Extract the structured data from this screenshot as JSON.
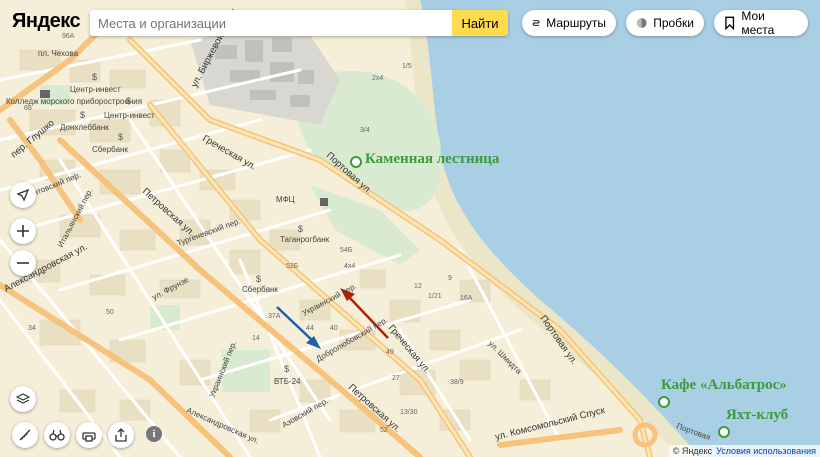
{
  "header": {
    "logo": "Яндекс",
    "search_placeholder": "Места и организации",
    "search_button": "Найти",
    "routes_label": "Маршруты",
    "traffic_label": "Пробки",
    "places_label": "Мои места"
  },
  "poi": {
    "stone_stairs": "Каменная лестница",
    "cafe": "Кафе «Альбатрос»",
    "yacht_club": "Яхт-клуб"
  },
  "streets": {
    "birzhevoy": "ул. Биржевой Спуск",
    "chekhova": "пл. Чехова",
    "glushko": "пер. Глушко",
    "grecheskaya_top": "Греческая ул.",
    "portovaya_top": "Портовая ул.",
    "petrovskaya_top": "Петровская ул.",
    "montovsky": "Монтовский пер.",
    "italyansky": "Итальянский пер.",
    "turgenevsky": "Тургеневский пер.",
    "aleksandrovskaya": "Александровская ул.",
    "frunze": "ул. Фрунзе",
    "ukrainsky_top": "Украинский пер.",
    "dobrolyubovsky": "Добролюбовский пер.",
    "ukrainsky_bottom": "Украинский пер.",
    "grecheskaya_bottom": "Греческая ул.",
    "shmidta": "ул. Шмидта",
    "portovaya_bottom": "Портовая ул.",
    "komsomolsky": "ул. Комсомольский Спуск",
    "petrovskaya_bottom": "Петровская ул.",
    "aleksandrovskaya_bottom": "Александровская ул.",
    "azovsky": "Азовский пер.",
    "portovaya_corner": "Портовая"
  },
  "labels": {
    "center_invest1": "Центр-инвест",
    "center_invest2": "Центр-инвест",
    "college": "Колледж морского приборостроения",
    "donkhlebbank": "Донхлеббанк",
    "sberbank1": "Сбербанк",
    "mfc": "МФЦ",
    "taganrogbank": "Таганрогбанк",
    "sberbank2": "Сбербанк",
    "vtb": "ВТБ-24"
  },
  "numbers": [
    "96А",
    "68",
    "2х4",
    "1/5",
    "3/4",
    "54Б",
    "52Б",
    "4х4",
    "1/21",
    "16А",
    "12",
    "44",
    "40",
    "37А",
    "14",
    "9",
    "38/9",
    "49",
    "27",
    "13/30",
    "52",
    "34",
    "50"
  ],
  "footer": {
    "copyright": "© Яндекс",
    "terms": "Условия использования"
  },
  "colors": {
    "sea": "#a9cfe4",
    "land": "#f5efd9",
    "park": "#d8ead0",
    "main_road": "#f7c27c",
    "arrow_red": "#b31e0b",
    "arrow_blue": "#1f5fb0",
    "poi_green": "#3d9b3d"
  },
  "icons": [
    "search-icon",
    "route-icon",
    "traffic-icon",
    "bookmark-icon",
    "locate-icon",
    "zoom-in-icon",
    "zoom-out-icon",
    "layers-icon",
    "ruler-icon",
    "binoculars-icon",
    "print-icon",
    "share-icon",
    "info-icon"
  ]
}
